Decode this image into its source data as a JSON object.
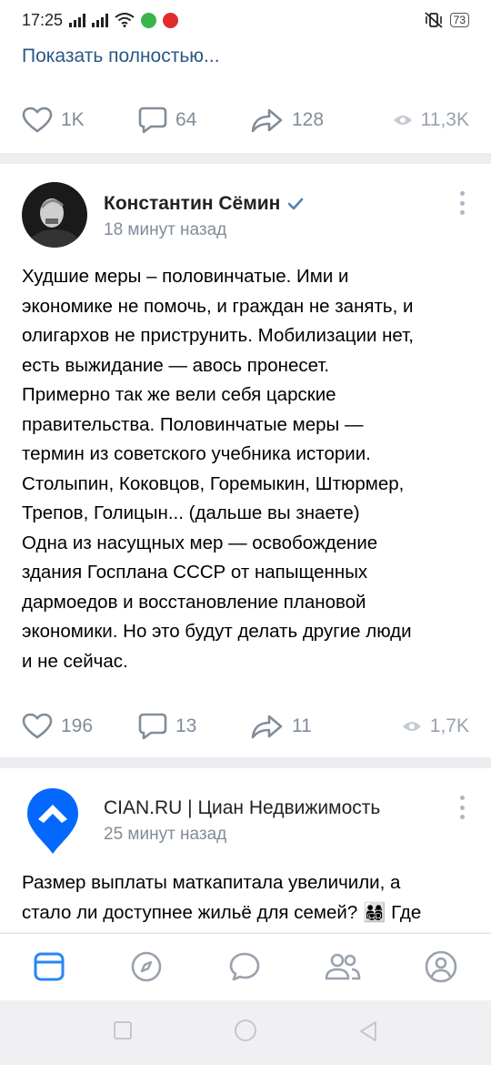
{
  "status": {
    "time": "17:25",
    "battery": "73"
  },
  "posts": [
    {
      "show_more": "Показать полностью...",
      "likes": "1K",
      "comments": "64",
      "shares": "128",
      "views": "11,3K"
    },
    {
      "author": "Константин Сёмин",
      "verified": true,
      "time": "18 минут назад",
      "text_lines": [
        "Худшие меры – половинчатые. Ими и",
        "экономике не помочь, и граждан не занять, и",
        "олигархов не приструнить. Мобилизации нет,",
        "есть выжидание — авось пронесет.",
        "Примерно так же вели себя царские",
        "правительства. Половинчатые меры —",
        "термин из советского учебника истории.",
        "Столыпин, Коковцов, Горемыкин, Штюрмер,",
        "Трепов, Голицын... (дальше вы знаете)",
        "Одна из насущных мер — освобождение",
        "здания Госплана СССР от напыщенных",
        "дармоедов и восстановление плановой",
        "экономики. Но это будут делать другие люди",
        "и не сейчас."
      ],
      "likes": "196",
      "comments": "13",
      "shares": "11",
      "views": "1,7K"
    },
    {
      "author": "CIAN.RU | Циан Недвижимость",
      "time": "25 минут назад",
      "text_lines": [
        "Размер выплаты маткапитала увеличили, а",
        "стало ли доступнее жильё для семей?",
        "Где"
      ],
      "emoji": "👨‍👩‍👧‍👦"
    }
  ],
  "colors": {
    "link": "#2a5885",
    "icon": "#99a2ad",
    "accent": "#2787f5",
    "verified": "#5181b8"
  },
  "tabs": [
    "news-icon",
    "discover-icon",
    "messages-icon",
    "friends-icon",
    "profile-icon"
  ]
}
